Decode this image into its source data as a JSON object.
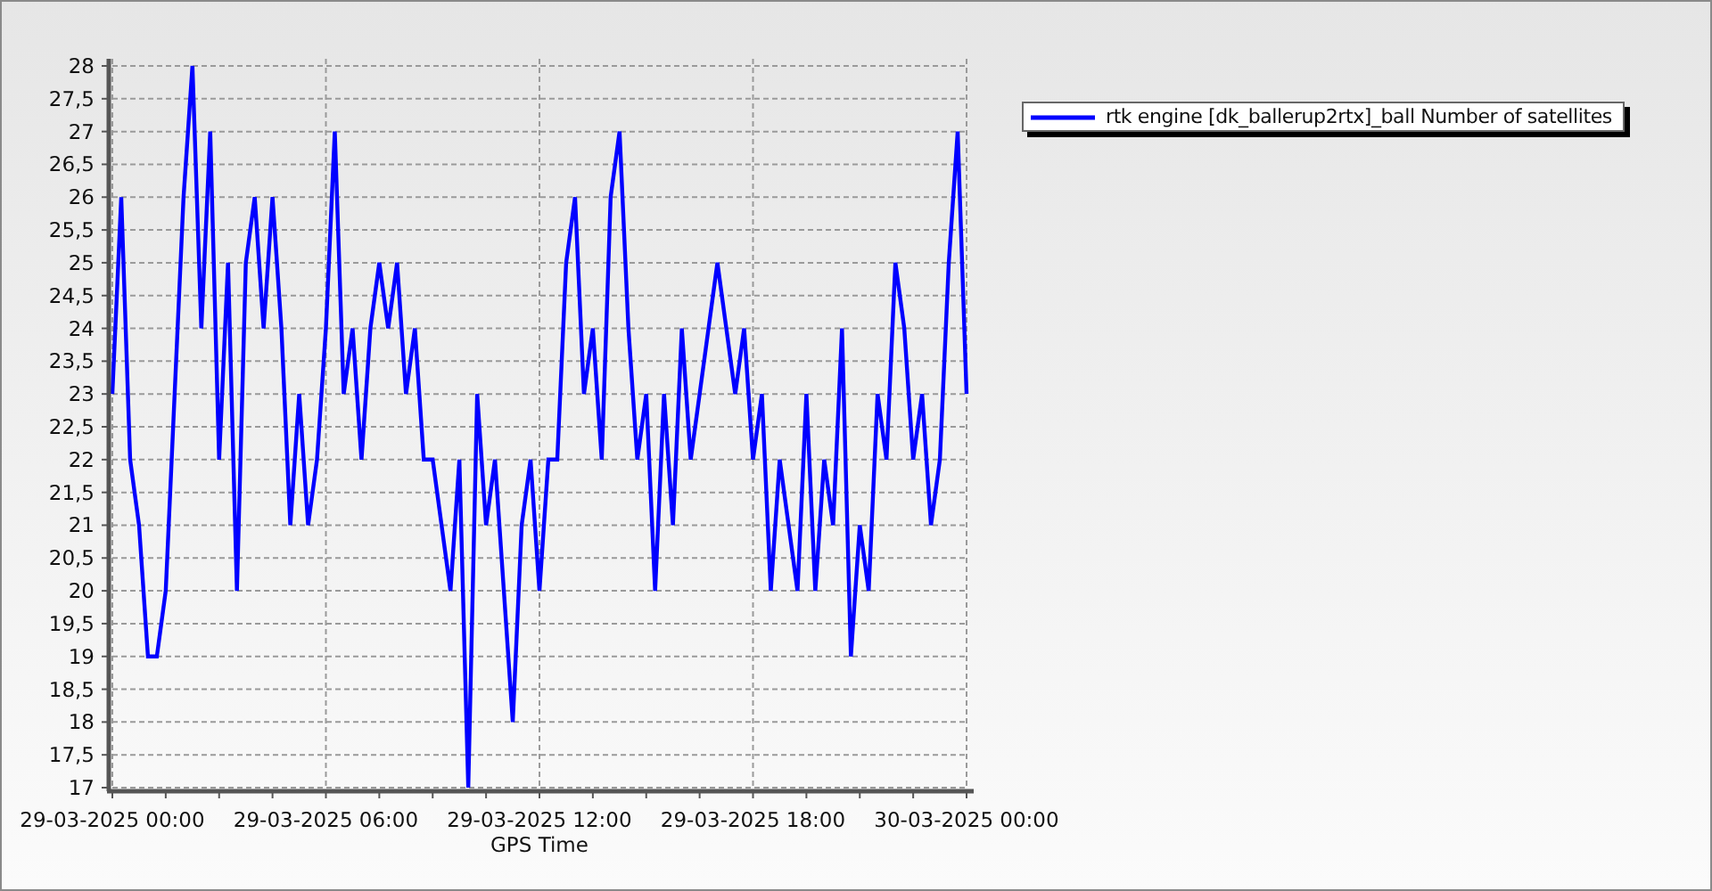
{
  "chart_data": {
    "type": "line",
    "xlabel": "GPS Time",
    "categories": [
      "29-03-2025 00:00",
      null,
      null,
      null,
      null,
      null,
      null,
      null,
      null,
      null,
      null,
      null,
      null,
      null,
      null,
      null,
      null,
      null,
      null,
      null,
      null,
      null,
      null,
      null,
      "29-03-2025 06:00",
      null,
      null,
      null,
      null,
      null,
      null,
      null,
      null,
      null,
      null,
      null,
      null,
      null,
      null,
      null,
      null,
      null,
      null,
      null,
      null,
      null,
      null,
      null,
      "29-03-2025 12:00",
      null,
      null,
      null,
      null,
      null,
      null,
      null,
      null,
      null,
      null,
      null,
      null,
      null,
      null,
      null,
      null,
      null,
      null,
      null,
      null,
      null,
      null,
      null,
      "29-03-2025 18:00",
      null,
      null,
      null,
      null,
      null,
      null,
      null,
      null,
      null,
      null,
      null,
      null,
      null,
      null,
      null,
      null,
      null,
      null,
      null,
      null,
      null,
      null,
      null,
      "30-03-2025 00:00"
    ],
    "series": [
      {
        "name": "rtk engine [dk_ballerup2rtx]_ball Number of satellites",
        "color": "#0000ff",
        "values": [
          23,
          26,
          22,
          21,
          19,
          19,
          20,
          23,
          26,
          28,
          24,
          27,
          22,
          25,
          20,
          25,
          26,
          24,
          26,
          24,
          21,
          23,
          21,
          22,
          24,
          27,
          23,
          24,
          22,
          24,
          25,
          24,
          25,
          23,
          24,
          22,
          22,
          21,
          20,
          22,
          17,
          23,
          21,
          22,
          20,
          18,
          21,
          22,
          20,
          22,
          22,
          25,
          26,
          23,
          24,
          22,
          26,
          27,
          24,
          22,
          23,
          20,
          23,
          21,
          24,
          22,
          23,
          24,
          25,
          24,
          23,
          24,
          22,
          23,
          20,
          22,
          21,
          20,
          23,
          20,
          22,
          21,
          24,
          19,
          21,
          20,
          23,
          22,
          25,
          24,
          22,
          23,
          21,
          22,
          25,
          27,
          23
        ]
      }
    ],
    "ylim": [
      17,
      28
    ],
    "grid": true,
    "yticks": [
      {
        "value": 17,
        "label": "17"
      },
      {
        "value": 17.5,
        "label": "17,5"
      },
      {
        "value": 18,
        "label": "18"
      },
      {
        "value": 18.5,
        "label": "18,5"
      },
      {
        "value": 19,
        "label": "19"
      },
      {
        "value": 19.5,
        "label": "19,5"
      },
      {
        "value": 20,
        "label": "20"
      },
      {
        "value": 20.5,
        "label": "20,5"
      },
      {
        "value": 21,
        "label": "21"
      },
      {
        "value": 21.5,
        "label": "21,5"
      },
      {
        "value": 22,
        "label": "22"
      },
      {
        "value": 22.5,
        "label": "22,5"
      },
      {
        "value": 23,
        "label": "23"
      },
      {
        "value": 23.5,
        "label": "23,5"
      },
      {
        "value": 24,
        "label": "24"
      },
      {
        "value": 24.5,
        "label": "24,5"
      },
      {
        "value": 25,
        "label": "25"
      },
      {
        "value": 25.5,
        "label": "25,5"
      },
      {
        "value": 26,
        "label": "26"
      },
      {
        "value": 26.5,
        "label": "26,5"
      },
      {
        "value": 27,
        "label": "27"
      },
      {
        "value": 27.5,
        "label": "27,5"
      },
      {
        "value": 28,
        "label": "28"
      }
    ]
  }
}
